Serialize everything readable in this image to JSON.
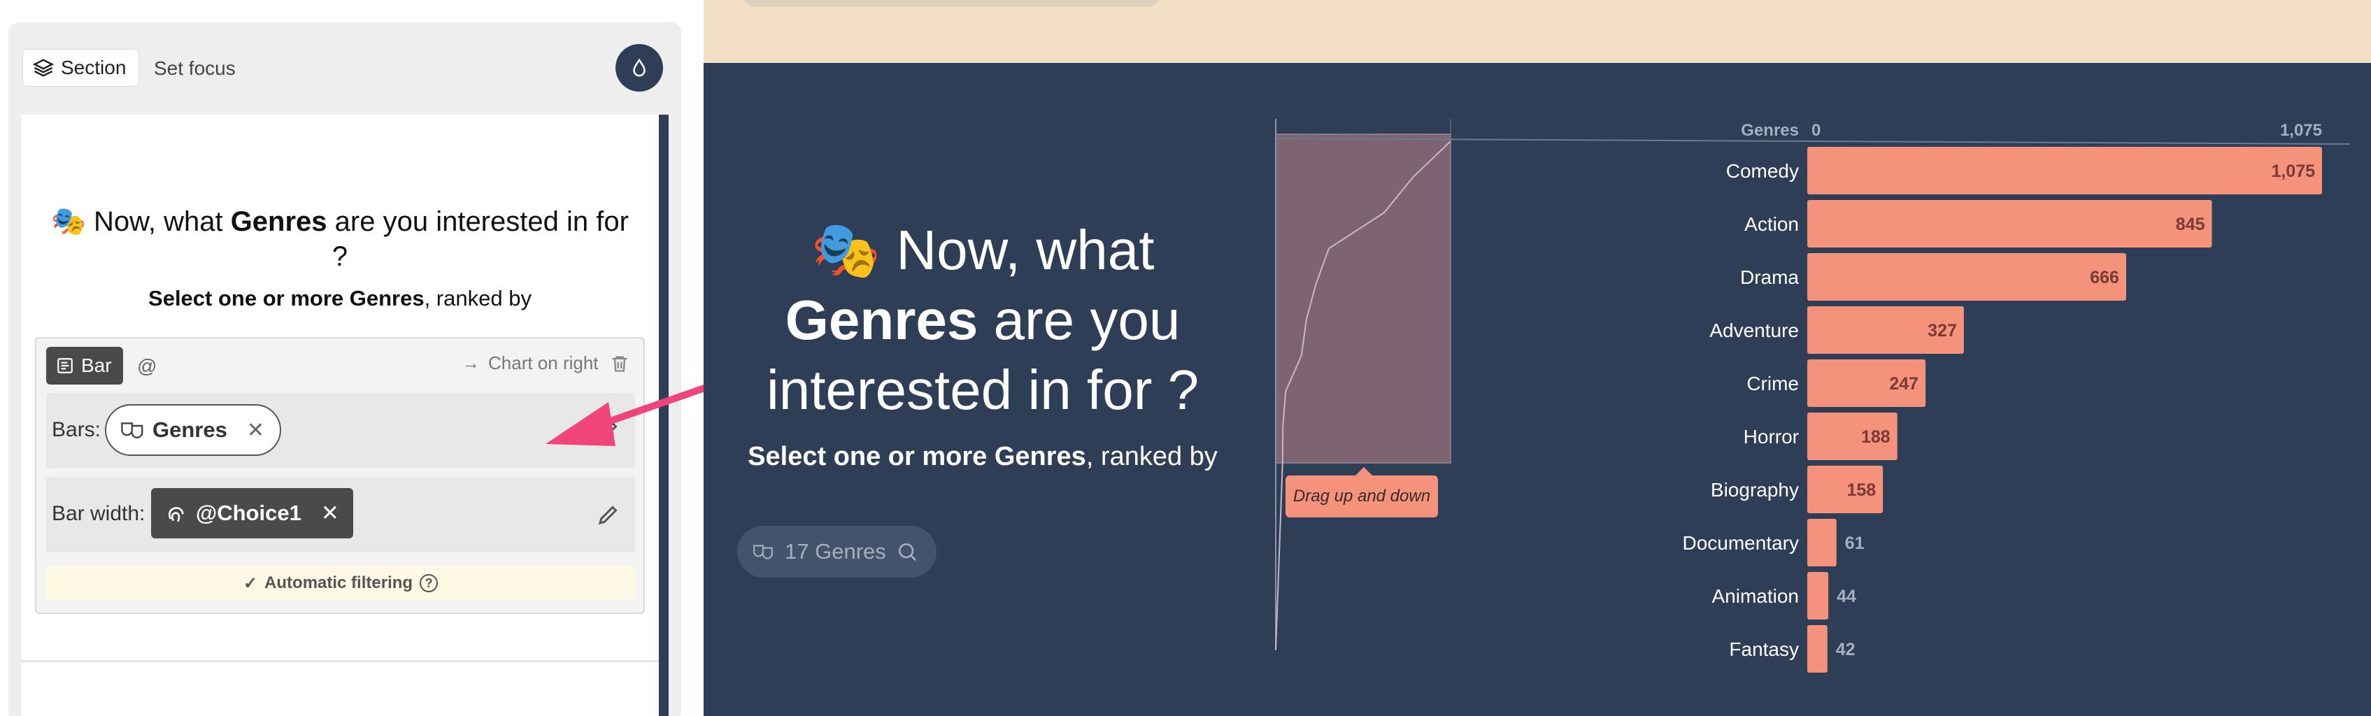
{
  "editor": {
    "section_tab_label": "Section",
    "set_focus_label": "Set focus",
    "drop_icon": "drop-icon",
    "title_prefix": "Now, what ",
    "title_bold": "Genres",
    "title_suffix": " are you interested in for ?",
    "subtitle_bold": "Select one or more Genres",
    "subtitle_rest": ", ranked by",
    "chart": {
      "type_label": "Bar",
      "at_label": "@",
      "position_label": "Chart on right",
      "bars_label": "Bars:",
      "bars_value": "Genres",
      "bar_width_label": "Bar width:",
      "bar_width_value": "@Choice1",
      "auto_filter_label": "Automatic filtering"
    }
  },
  "preview": {
    "title_prefix": "Now, what",
    "title_bold": "Genres",
    "title_suffix": " are you interested in for ?",
    "subtitle_bold": "Select one or more Genres",
    "subtitle_rest": ", ranked by",
    "search_label": "17 Genres",
    "drag_tip": "Drag up and down"
  },
  "colors": {
    "panel_dark": "#2e3e56",
    "bar_fill": "#f4927c",
    "arrow": "#f0457a",
    "top_band": "#f2dfc6"
  },
  "chart_data": {
    "type": "bar",
    "orientation": "horizontal",
    "title": "",
    "xlabel": "",
    "ylabel": "Genres",
    "xlim": [
      0,
      1075
    ],
    "axis_tick_labels": [
      "0",
      "1,075"
    ],
    "categories": [
      "Comedy",
      "Action",
      "Drama",
      "Adventure",
      "Crime",
      "Horror",
      "Biography",
      "Documentary",
      "Animation",
      "Fantasy"
    ],
    "values": [
      1075,
      845,
      666,
      327,
      247,
      188,
      158,
      61,
      44,
      42
    ],
    "value_labels": [
      "1,075",
      "845",
      "666",
      "327",
      "247",
      "188",
      "158",
      "61",
      "44",
      "42"
    ],
    "grid": false,
    "legend": "none"
  }
}
